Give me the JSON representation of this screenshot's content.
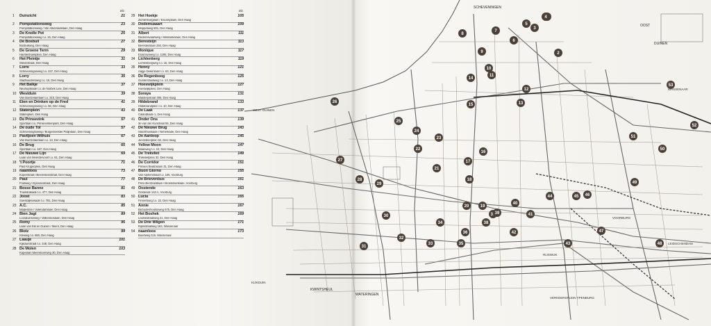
{
  "index": {
    "left_header": "Blz.",
    "right_header": "Blz.",
    "left_entries": [
      {
        "num": "1",
        "name": "Duinzicht",
        "addr": "",
        "page": "21"
      },
      {
        "num": "2",
        "name": "Pompstationsweg",
        "addr": "Pompstationsweg / Van Alkemadelaan, Den Haag",
        "page": "23"
      },
      {
        "num": "3",
        "name": "De Knolle Pot",
        "addr": "Pompstationsweg t.o. 15, Den Haag",
        "page": "25"
      },
      {
        "num": "4",
        "name": "De Bosbuil",
        "addr": "Bosbuilweg, Den Haag",
        "page": "27"
      },
      {
        "num": "5",
        "name": "De Groene Term",
        "addr": "Harstenhoekplein, Den Haag",
        "page": "29"
      },
      {
        "num": "6",
        "name": "Het Pleintje",
        "addr": "Stevinstraat, Den Haag",
        "page": "31"
      },
      {
        "num": "7",
        "name": "Lorre",
        "addr": "Scheveningseweg t.o. 237, Den Haag",
        "page": "33"
      },
      {
        "num": "8",
        "name": "Lorry",
        "addr": "Stadhoudersweg t.o. 16, Den Haag",
        "page": "35"
      },
      {
        "num": "9",
        "name": "Het Balkje",
        "addr": "Neuhuyskade t.o. de Norbek Line, Den Haag",
        "page": "37"
      },
      {
        "num": "10",
        "name": "Westduin",
        "addr": "Van Boetzelaerlaan t.o. 310, Den Haag",
        "page": "39"
      },
      {
        "num": "11",
        "name": "Eten en Drinken op de Fred",
        "addr": "Scheveningseweg t.o. 56, Den Haag",
        "page": "41"
      },
      {
        "num": "12",
        "name": "Statenplein",
        "addr": "Statenplein, Den Haag",
        "page": "43"
      },
      {
        "num": "13",
        "name": "De Prinsevink",
        "addr": "Sportlaan t.o. Prinsevinkenpark, Den Haag",
        "page": "57"
      },
      {
        "num": "14",
        "name": "De oude Tol",
        "addr": "Scheveningseweg / Burgemeester Patijnlaan, Den Haag",
        "page": "57"
      },
      {
        "num": "15",
        "name": "Paviljoen Wilhuis",
        "addr": "Van Boetzelaerlaan t.o. 13, Den Haag",
        "page": "67"
      },
      {
        "num": "16",
        "name": "De Brug",
        "addr": "Sportlaan t.o. 187, Den Haag",
        "page": "65"
      },
      {
        "num": "17",
        "name": "De Nieuwe Lijn",
        "addr": "Laan van Meerdervoort t.o. 81, Den Haag",
        "page": "69"
      },
      {
        "num": "18",
        "name": "'t Poortje",
        "addr": "Paul Krugerplein, Den Haag",
        "page": "71"
      },
      {
        "num": "19",
        "name": "naamloos",
        "addr": "Koperstraat / Beeresteinstraat, Den Haag",
        "page": "73"
      },
      {
        "num": "20",
        "name": "Paul",
        "addr": "Fruitweg / Dynamostraat, Den Haag",
        "page": "77"
      },
      {
        "num": "21",
        "name": "Bosse Banne",
        "addr": "Troelstrakade t.o. 477, Den Haag",
        "page": "81"
      },
      {
        "num": "22",
        "name": "Joost",
        "addr": "Soestdijksekade t.o. 781, Den Haag",
        "page": "83"
      },
      {
        "num": "23",
        "name": "A.C.",
        "addr": "Madestein / Volendamlaan, Den Haag",
        "page": "85"
      },
      {
        "num": "24",
        "name": "Bien Jagt",
        "addr": "Loosduinseweg / Valkenboslaan, Den Haag",
        "page": "89"
      },
      {
        "num": "25",
        "name": "Romy",
        "addr": "Laan van Eik en Duinen / Mient, Den Haag",
        "page": "95"
      },
      {
        "num": "26",
        "name": "Blotz",
        "addr": "Kleiweg t.o. 860, Den Haag",
        "page": "99"
      },
      {
        "num": "27",
        "name": "Laauje",
        "addr": "Kijkduinstraat t.o. 348, Den Haag",
        "page": "101"
      },
      {
        "num": "28",
        "name": "De Molen",
        "addr": "Kapelaan Meereboerweg 30, Den Haag",
        "page": "103"
      }
    ],
    "right_entries": [
      {
        "num": "29",
        "name": "Het Hoekje",
        "addr": "Zichtenburglaan / Escamplaan, Den Haag",
        "page": "105"
      },
      {
        "num": "30",
        "name": "Dodemuaaart",
        "addr": "Meppelweg 801, Den Haag",
        "page": "109"
      },
      {
        "num": "31",
        "name": "Albert",
        "addr": "Dedemsvaartweg / Melissekelaan, Den Haag",
        "page": "111"
      },
      {
        "num": "32",
        "name": "Beresteijn",
        "addr": "Beresteinlaan 294, Den Haag",
        "page": "113"
      },
      {
        "num": "33",
        "name": "Monique",
        "addr": "Erasmusweg t.o. 1185, Den Haag",
        "page": "117"
      },
      {
        "num": "34",
        "name": "Lichtenberg",
        "addr": "Lichtenbergweg t.o. 15, Den Haag",
        "page": "119"
      },
      {
        "num": "35",
        "name": "Henny",
        "addr": "Aagje Dekenlaan t.o. 63, Den Haag",
        "page": "121"
      },
      {
        "num": "36",
        "name": "De Regenboog",
        "addr": "Gunterstraatweg t.o. 13, Den Haag",
        "page": "125"
      },
      {
        "num": "37",
        "name": "Hoeswijkplein",
        "addr": "Hoeswijkplein, Den Haag",
        "page": "127"
      },
      {
        "num": "38",
        "name": "Soraya",
        "addr": "Walderpstraat 499, Den Haag",
        "page": "131"
      },
      {
        "num": "39",
        "name": "Hildebrand",
        "addr": "Hildebrandplein t.o. 10, Den Haag",
        "page": "133"
      },
      {
        "num": "40",
        "name": "De Laak",
        "addr": "Calandkade 1, Den Haag",
        "page": "137"
      },
      {
        "num": "41",
        "name": "Onder Ons",
        "addr": "3e van der Kunstraat 55, Den Haag",
        "page": "139"
      },
      {
        "num": "42",
        "name": "De Nieuwe Brug",
        "addr": "Slachthuiskade / Neherkade, Den Haag",
        "page": "143"
      },
      {
        "num": "43",
        "name": "De Aanloop",
        "addr": "Junckbeerplein 52, Den Haag",
        "page": "145"
      },
      {
        "num": "44",
        "name": "Yellow Moon",
        "addr": "Maanweg t.o. 24, Den Haag",
        "page": "147"
      },
      {
        "num": "45",
        "name": "De Trekvliet",
        "addr": "Trekvlietplein 32, Den Haag",
        "page": "149"
      },
      {
        "num": "46",
        "name": "De Corridor",
        "addr": "Prinses Beatrixlaan 31, Den Haag",
        "page": "151"
      },
      {
        "num": "47",
        "name": "Buon Giorno",
        "addr": "Van Alphenstraat t.o. 106, Voorburg",
        "page": "155"
      },
      {
        "num": "48",
        "name": "De Brievenbus",
        "addr": "Prins Bernhardlaan / Broeksloetkade, Voorburg",
        "page": "161"
      },
      {
        "num": "49",
        "name": "Oostende",
        "addr": "Oostende 142 A, Voorburg",
        "page": "163"
      },
      {
        "num": "50",
        "name": "Lucia",
        "addr": "Finnenburg t.o. 22, Den Haag",
        "page": "165"
      },
      {
        "num": "51",
        "name": "Annie",
        "addr": "Bezuidenhoutseweg 675, Den Haag",
        "page": "167"
      },
      {
        "num": "52",
        "name": "Het Boshek",
        "addr": "Leidsestraatweg 21, Den Haag",
        "page": "169"
      },
      {
        "num": "53",
        "name": "De Drie Wilgen",
        "addr": "Rijksstraatweg 163, Wassenaar",
        "page": "171"
      },
      {
        "num": "54",
        "name": "naamloos",
        "addr": "Buurtweg 116, Wassenaar",
        "page": "173"
      }
    ]
  },
  "map": {
    "places": {
      "scheveningen": "SCHEVENINGEN",
      "oost": "OOST",
      "duinen": "DUINEN",
      "west_duinen": "WEST DUINEN",
      "waterin": "WATERINGEN",
      "kwintsheul": "KWINTSHEUL",
      "voorburg": "VOORBURG",
      "leidschendam": "LEIDSCHENDAM",
      "waddenaar": "WASSENAAR",
      "kijkduin": "KIJKDUIN",
      "rijswijk": "RIJSWIJK",
      "ypenburg": "VERKEERSPLEIN YPENBURG"
    },
    "markers": [
      "1",
      "2",
      "3",
      "4",
      "5",
      "6",
      "7",
      "8",
      "9",
      "10",
      "11",
      "12",
      "13",
      "14",
      "15",
      "16",
      "17",
      "18",
      "19",
      "20",
      "21",
      "22",
      "23",
      "24",
      "25",
      "26",
      "27",
      "28",
      "29",
      "30",
      "31",
      "32",
      "33",
      "34",
      "35",
      "36",
      "37",
      "38",
      "39",
      "40",
      "41",
      "42",
      "43",
      "44",
      "45",
      "46",
      "47",
      "48",
      "49",
      "50",
      "51",
      "52",
      "53"
    ],
    "marker_color": "#4a4037"
  }
}
